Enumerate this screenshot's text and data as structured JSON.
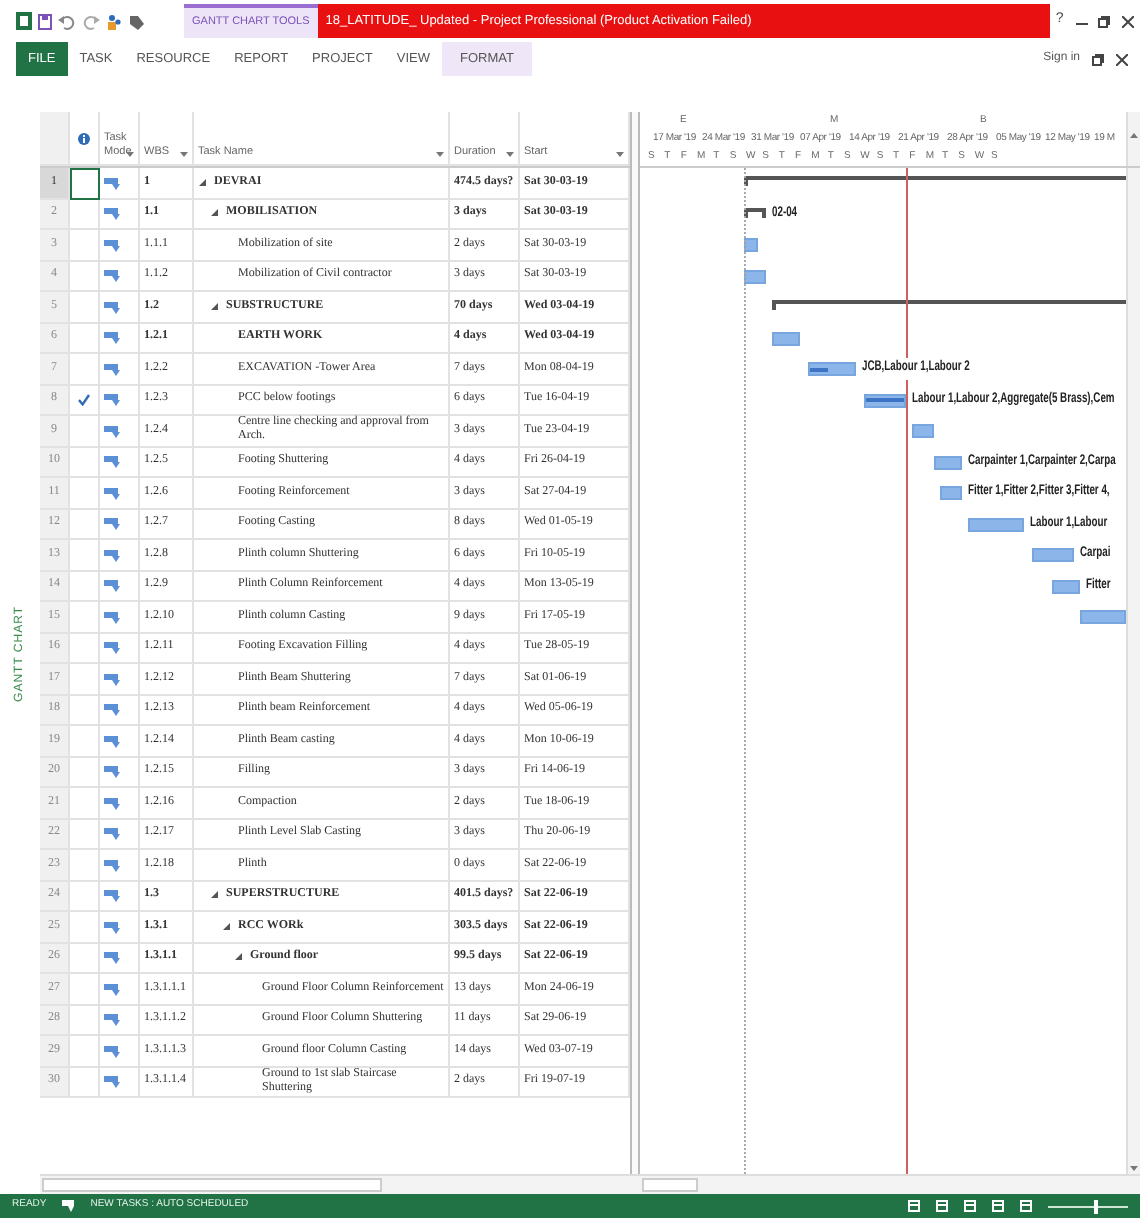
{
  "window": {
    "context_tab": "GANTT CHART TOOLS",
    "title": "18_LATITUDE_ Updated -  Project Professional (Product Activation Failed)",
    "help": "?"
  },
  "ribbon": {
    "tabs": [
      {
        "label": "FILE",
        "kind": "file"
      },
      {
        "label": "TASK",
        "kind": "normal"
      },
      {
        "label": "RESOURCE",
        "kind": "normal"
      },
      {
        "label": "REPORT",
        "kind": "normal"
      },
      {
        "label": "PROJECT",
        "kind": "normal"
      },
      {
        "label": "VIEW",
        "kind": "normal"
      },
      {
        "label": "FORMAT",
        "kind": "contextual"
      }
    ],
    "sign_in": "Sign in"
  },
  "side_label": "GANTT CHART",
  "columns": [
    {
      "label": "Task Mode"
    },
    {
      "label": "WBS"
    },
    {
      "label": "Task Name"
    },
    {
      "label": "Duration"
    },
    {
      "label": "Start"
    }
  ],
  "timescale": {
    "top_tier": [
      "E",
      "M",
      "B"
    ],
    "weeks": [
      "17 Mar '19",
      "24 Mar '19",
      "31 Mar '19",
      "07 Apr '19",
      "14 Apr '19",
      "21 Apr '19",
      "28 Apr '19",
      "05 May '19",
      "12 May '19",
      "19 M"
    ],
    "days": [
      "S",
      "T",
      "F",
      "M",
      "T",
      "S",
      "W",
      "S",
      "T",
      "F",
      "M",
      "T",
      "S",
      "W",
      "S",
      "T",
      "F",
      "M",
      "T",
      "S",
      "W",
      "S"
    ]
  },
  "tasks": [
    {
      "row": "1",
      "wbs": "1",
      "name": "DEVRAI",
      "duration": "474.5 days?",
      "start": "Sat 30-03-19",
      "bold": true,
      "selected": true,
      "complete": false,
      "expanded": true,
      "children": [
        {
          "row": "2",
          "wbs": "1.1",
          "name": "MOBILISATION",
          "duration": "3 days",
          "start": "Sat 30-03-19",
          "bold": true,
          "selected": false,
          "complete": false,
          "expanded": true,
          "bar_label": "02-04",
          "children": [
            {
              "row": "3",
              "wbs": "1.1.1",
              "name": "Mobilization of site",
              "duration": "2 days",
              "start": "Sat 30-03-19",
              "bold": false,
              "selected": false,
              "complete": false
            },
            {
              "row": "4",
              "wbs": "1.1.2",
              "name": "Mobilization of Civil contractor",
              "duration": "3 days",
              "start": "Sat 30-03-19",
              "bold": false,
              "selected": false,
              "complete": false
            }
          ]
        },
        {
          "row": "5",
          "wbs": "1.2",
          "name": "SUBSTRUCTURE",
          "duration": "70 days",
          "start": "Wed 03-04-19",
          "bold": true,
          "selected": false,
          "complete": false,
          "expanded": true,
          "children": [
            {
              "row": "6",
              "wbs": "1.2.1",
              "name": "EARTH WORK",
              "duration": "4 days",
              "start": "Wed 03-04-19",
              "bold": true,
              "selected": false,
              "complete": false
            },
            {
              "row": "7",
              "wbs": "1.2.2",
              "name": "EXCAVATION -Tower Area",
              "duration": "7 days",
              "start": "Mon 08-04-19",
              "bold": false,
              "selected": false,
              "complete": false,
              "level": 0.4,
              "bar_label": "JCB,Labour 1,Labour 2"
            },
            {
              "row": "8",
              "wbs": "1.2.3",
              "name": "PCC below footings",
              "duration": "6 days",
              "start": "Tue 16-04-19",
              "bold": false,
              "selected": false,
              "complete": true,
              "level": 1,
              "bar_label": "Labour 1,Labour 2,Aggregate(5 Brass),Cem"
            },
            {
              "row": "9",
              "wbs": "1.2.4",
              "name": "Centre line checking and approval from Arch.",
              "duration": "3 days",
              "start": "Tue 23-04-19",
              "bold": false,
              "selected": false,
              "complete": false
            },
            {
              "row": "10",
              "wbs": "1.2.5",
              "name": "Footing Shuttering",
              "duration": "4 days",
              "start": "Fri 26-04-19",
              "bold": false,
              "selected": false,
              "complete": false,
              "bar_label": "Carpainter 1,Carpainter 2,Carpa"
            },
            {
              "row": "11",
              "wbs": "1.2.6",
              "name": "Footing Reinforcement",
              "duration": "3 days",
              "start": "Sat 27-04-19",
              "bold": false,
              "selected": false,
              "complete": false,
              "bar_label": "Fitter 1,Fitter 2,Fitter 3,Fitter 4,"
            },
            {
              "row": "12",
              "wbs": "1.2.7",
              "name": "Footing Casting",
              "duration": "8 days",
              "start": "Wed 01-05-19",
              "bold": false,
              "selected": false,
              "complete": false,
              "bar_label": "Labour 1,Labour"
            },
            {
              "row": "13",
              "wbs": "1.2.8",
              "name": "Plinth column Shuttering",
              "duration": "6 days",
              "start": "Fri 10-05-19",
              "bold": false,
              "selected": false,
              "complete": false,
              "bar_label": "Carpai"
            },
            {
              "row": "14",
              "wbs": "1.2.9",
              "name": "Plinth Column Reinforcement",
              "duration": "4 days",
              "start": "Mon 13-05-19",
              "bold": false,
              "selected": false,
              "complete": false,
              "bar_label": "Fitter"
            },
            {
              "row": "15",
              "wbs": "1.2.10",
              "name": "Plinth column Casting",
              "duration": "9 days",
              "start": "Fri 17-05-19",
              "bold": false,
              "selected": false,
              "complete": false
            },
            {
              "row": "16",
              "wbs": "1.2.11",
              "name": "Footing Excavation Filling",
              "duration": "4 days",
              "start": "Tue 28-05-19",
              "bold": false,
              "selected": false,
              "complete": false
            },
            {
              "row": "17",
              "wbs": "1.2.12",
              "name": "Plinth Beam Shuttering",
              "duration": "7 days",
              "start": "Sat 01-06-19",
              "bold": false,
              "selected": false,
              "complete": false
            },
            {
              "row": "18",
              "wbs": "1.2.13",
              "name": "Plinth beam Reinforcement",
              "duration": "4 days",
              "start": "Wed 05-06-19",
              "bold": false,
              "selected": false,
              "complete": false
            },
            {
              "row": "19",
              "wbs": "1.2.14",
              "name": "Plinth Beam casting",
              "duration": "4 days",
              "start": "Mon 10-06-19",
              "bold": false,
              "selected": false,
              "complete": false
            },
            {
              "row": "20",
              "wbs": "1.2.15",
              "name": "Filling",
              "duration": "3 days",
              "start": "Fri 14-06-19",
              "bold": false,
              "selected": false,
              "complete": false
            },
            {
              "row": "21",
              "wbs": "1.2.16",
              "name": "Compaction",
              "duration": "2 days",
              "start": "Tue 18-06-19",
              "bold": false,
              "selected": false,
              "complete": false
            },
            {
              "row": "22",
              "wbs": "1.2.17",
              "name": "Plinth Level Slab Casting",
              "duration": "3 days",
              "start": "Thu 20-06-19",
              "bold": false,
              "selected": false,
              "complete": false
            },
            {
              "row": "23",
              "wbs": "1.2.18",
              "name": "Plinth",
              "duration": "0 days",
              "start": "Sat 22-06-19",
              "bold": false,
              "selected": false,
              "complete": false
            }
          ]
        },
        {
          "row": "24",
          "wbs": "1.3",
          "name": "SUPERSTRUCTURE",
          "duration": "401.5 days?",
          "start": "Sat 22-06-19",
          "bold": true,
          "selected": false,
          "complete": false,
          "expanded": true,
          "children": [
            {
              "row": "25",
              "wbs": "1.3.1",
              "name": "RCC WORk",
              "duration": "303.5 days",
              "start": "Sat 22-06-19",
              "bold": true,
              "selected": false,
              "complete": false,
              "expanded": true,
              "children": [
                {
                  "row": "26",
                  "wbs": "1.3.1.1",
                  "name": "Ground floor",
                  "duration": "99.5 days",
                  "start": "Sat 22-06-19",
                  "bold": true,
                  "selected": false,
                  "complete": false,
                  "expanded": true,
                  "children": [
                    {
                      "row": "27",
                      "wbs": "1.3.1.1.1",
                      "name": "Ground Floor Column Reinforcement",
                      "duration": "13 days",
                      "start": "Mon 24-06-19",
                      "bold": false,
                      "selected": false,
                      "complete": false
                    },
                    {
                      "row": "28",
                      "wbs": "1.3.1.1.2",
                      "name": "Ground Floor Column Shuttering",
                      "duration": "11 days",
                      "start": "Sat 29-06-19",
                      "bold": false,
                      "selected": false,
                      "complete": false
                    },
                    {
                      "row": "29",
                      "wbs": "1.3.1.1.3",
                      "name": "Ground floor Column Casting",
                      "duration": "14 days",
                      "start": "Wed 03-07-19",
                      "bold": false,
                      "selected": false,
                      "complete": false
                    },
                    {
                      "row": "30",
                      "wbs": "1.3.1.1.4",
                      "name": "Ground to 1st slab Staircase Shuttering",
                      "duration": "2 days",
                      "start": "Fri 19-07-19",
                      "bold": false,
                      "selected": false,
                      "complete": false
                    }
                  ]
                }
              ]
            }
          ]
        }
      ]
    }
  ],
  "status_bar": {
    "ready": "READY",
    "new_tasks": "NEW TASKS : AUTO SCHEDULED",
    "zoom": {
      "level": 0.6
    }
  }
}
